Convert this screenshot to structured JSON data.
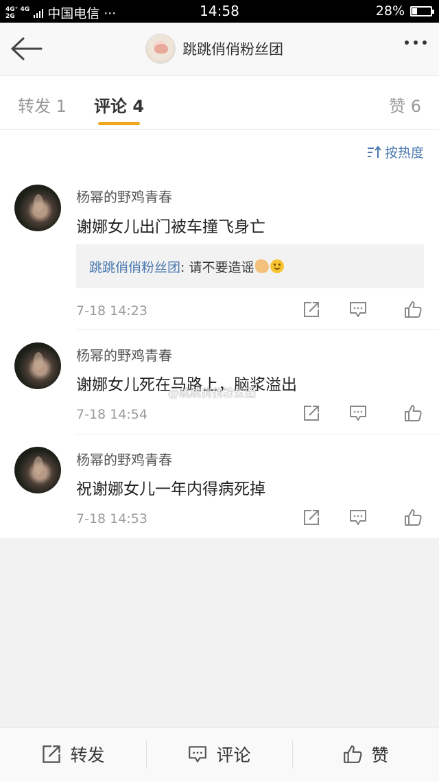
{
  "status_bar": {
    "network_top": "4G⁺ 4G",
    "network_bottom": "2G",
    "carrier": "中国电信 ···",
    "time": "14:58",
    "battery": "28%",
    "battery_level": 0.28
  },
  "nav": {
    "title": "跳跳俏俏粉丝团"
  },
  "tabs": [
    {
      "label": "转发 1"
    },
    {
      "label": "评论 4"
    },
    {
      "label": "赞 6"
    }
  ],
  "sort_label": "按热度",
  "comments": [
    {
      "user": "杨幂的野鸡青春",
      "text": "谢娜女儿出门被车撞飞身亡",
      "reply_user": "跳跳俏俏粉丝团",
      "reply_text": ": 请不要造谣",
      "time": "7-18 14:23"
    },
    {
      "user": "杨幂的野鸡青春",
      "text": "谢娜女儿死在马路上，脑浆溢出",
      "time": "7-18 14:54"
    },
    {
      "user": "杨幂的野鸡青春",
      "text": "祝谢娜女儿一年内得病死掉",
      "time": "7-18 14:53"
    }
  ],
  "watermark": "@跳跳俏俏粉丝团",
  "bottom_bar": {
    "repost": "转发",
    "comment": "评论",
    "like": "赞"
  },
  "colors": {
    "accent": "#f0a91b",
    "link": "#4a78b0"
  }
}
